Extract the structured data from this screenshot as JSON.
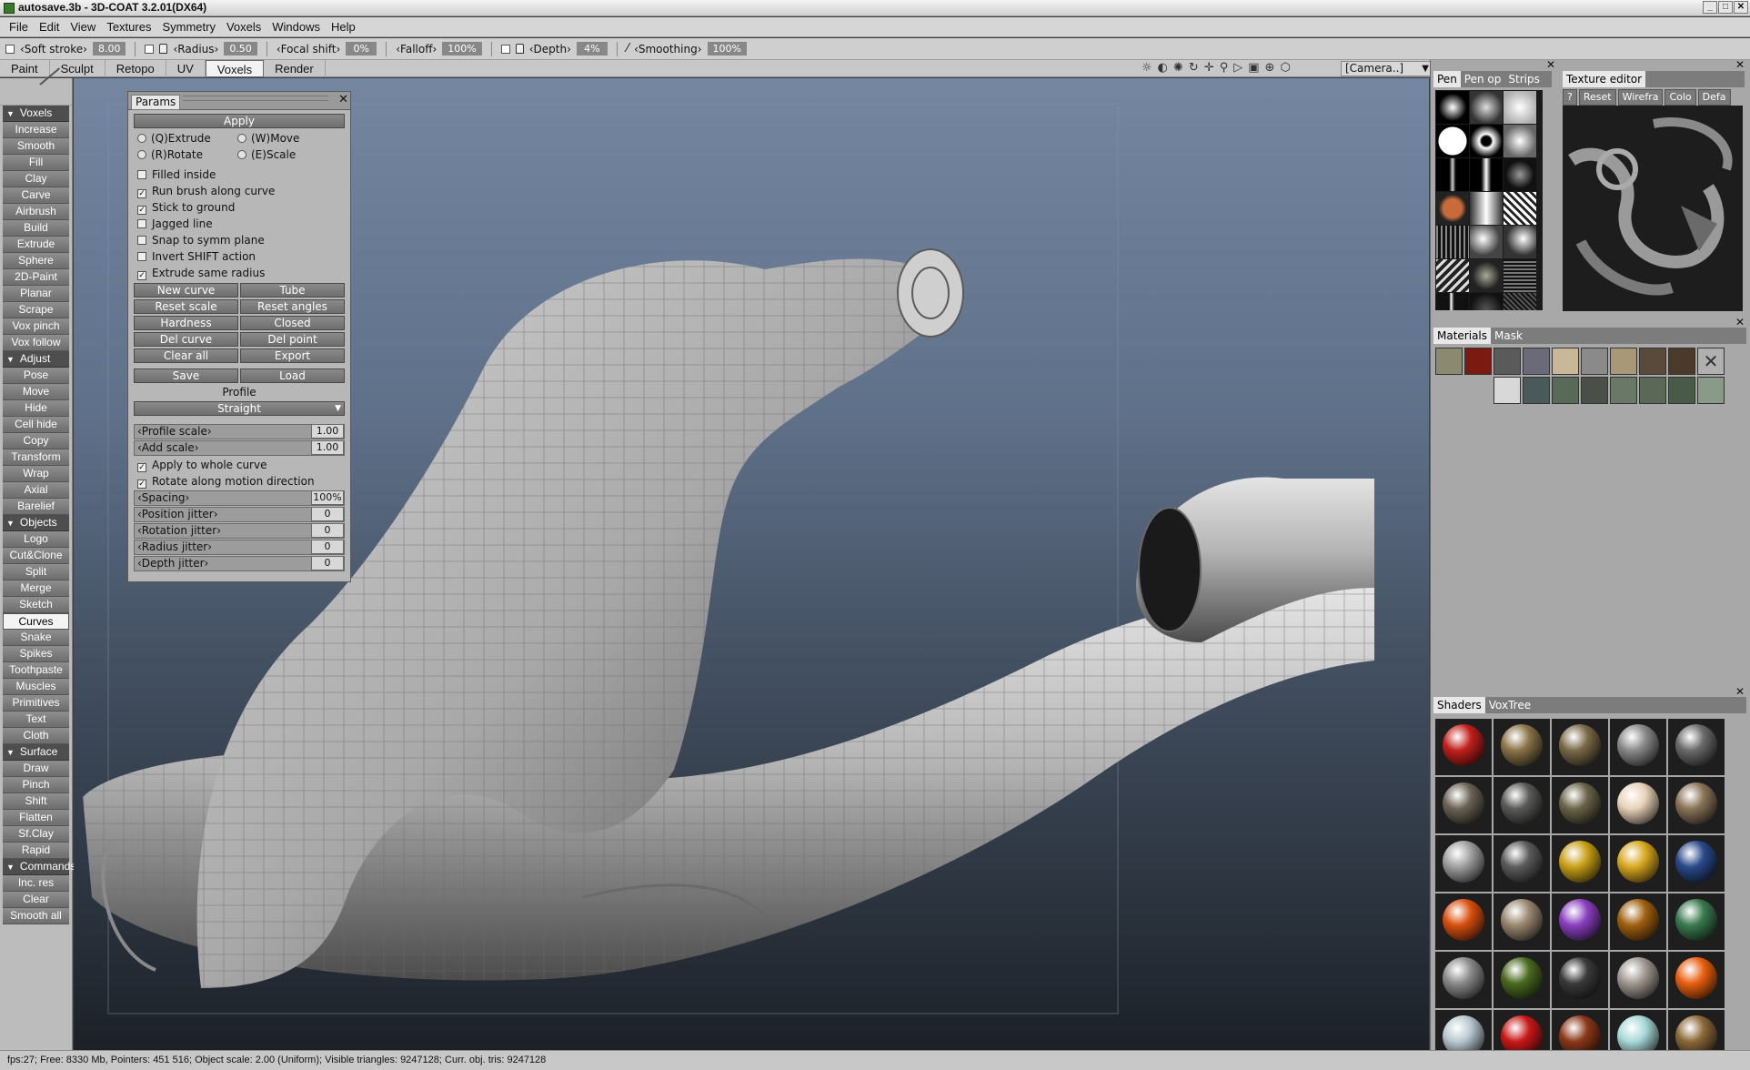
{
  "window": {
    "title": "autosave.3b - 3D-COAT 3.2.01(DX64)"
  },
  "menu": [
    "File",
    "Edit",
    "View",
    "Textures",
    "Symmetry",
    "Voxels",
    "Windows",
    "Help"
  ],
  "toolopts": {
    "soft_stroke_label": "‹Soft stroke›",
    "soft_stroke_value": "8.00",
    "radius_label": "‹Radius›",
    "radius_value": "0.50",
    "focal_label": "‹Focal shift›",
    "focal_value": "0%",
    "falloff_label": "‹Falloff›",
    "falloff_value": "100%",
    "depth_label": "‹Depth›",
    "depth_value": "4%",
    "smoothing_label": "‹Smoothing›",
    "smoothing_value": "100%"
  },
  "tabs": [
    "Paint",
    "Sculpt",
    "Retopo",
    "UV",
    "Voxels",
    "Render"
  ],
  "active_tab": "Voxels",
  "camera": "[Camera..]",
  "sidebar": [
    {
      "type": "section",
      "label": "Voxels"
    },
    {
      "label": "Increase"
    },
    {
      "label": "Smooth"
    },
    {
      "label": "Fill"
    },
    {
      "label": "Clay"
    },
    {
      "label": "Carve"
    },
    {
      "label": "Airbrush"
    },
    {
      "label": "Build"
    },
    {
      "label": "Extrude"
    },
    {
      "label": "Sphere"
    },
    {
      "label": "2D-Paint"
    },
    {
      "label": "Planar"
    },
    {
      "label": "Scrape"
    },
    {
      "label": "Vox pinch"
    },
    {
      "label": "Vox follow"
    },
    {
      "type": "section",
      "label": "Adjust"
    },
    {
      "label": "Pose"
    },
    {
      "label": "Move"
    },
    {
      "label": "Hide"
    },
    {
      "label": "Cell hide"
    },
    {
      "label": "Copy"
    },
    {
      "label": "Transform"
    },
    {
      "label": "Wrap"
    },
    {
      "label": "Axial"
    },
    {
      "label": "Barelief"
    },
    {
      "type": "section",
      "label": "Objects"
    },
    {
      "label": "Logo"
    },
    {
      "label": "Cut&Clone"
    },
    {
      "label": "Split"
    },
    {
      "label": "Merge"
    },
    {
      "label": "Sketch"
    },
    {
      "label": "Curves",
      "active": true
    },
    {
      "label": "Snake"
    },
    {
      "label": "Spikes"
    },
    {
      "label": "Toothpaste"
    },
    {
      "label": "Muscles"
    },
    {
      "label": "Primitives"
    },
    {
      "label": "Text"
    },
    {
      "label": "Cloth"
    },
    {
      "type": "section",
      "label": "Surface"
    },
    {
      "label": "Draw"
    },
    {
      "label": "Pinch"
    },
    {
      "label": "Shift"
    },
    {
      "label": "Flatten"
    },
    {
      "label": "Sf.Clay"
    },
    {
      "label": "Rapid"
    },
    {
      "type": "section",
      "label": "Commands"
    },
    {
      "label": "Inc. res"
    },
    {
      "label": "Clear"
    },
    {
      "label": "Smooth all"
    }
  ],
  "params": {
    "title": "Params",
    "apply": "Apply",
    "modes": [
      "(Q)Extrude",
      "(W)Move",
      "(R)Rotate",
      "(E)Scale"
    ],
    "checks": [
      {
        "label": "Filled inside",
        "checked": false
      },
      {
        "label": "Run brush along curve",
        "checked": true
      },
      {
        "label": "Stick to ground",
        "checked": true
      },
      {
        "label": "Jagged line",
        "checked": false
      },
      {
        "label": "Snap to symm plane",
        "checked": false
      },
      {
        "label": "Invert SHIFT action",
        "checked": false
      },
      {
        "label": "Extrude same radius",
        "checked": true
      }
    ],
    "buttons": [
      [
        "New curve",
        "Tube"
      ],
      [
        "Reset scale",
        "Reset angles"
      ],
      [
        "Hardness",
        "Closed"
      ],
      [
        "Del curve",
        "Del point"
      ],
      [
        "Clear all",
        "Export"
      ]
    ],
    "save": "Save",
    "load": "Load",
    "profile_label": "Profile",
    "profile_value": "Straight",
    "profile_scale_label": "‹Profile scale›",
    "profile_scale_value": "1.00",
    "add_scale_label": "‹Add scale›",
    "add_scale_value": "1.00",
    "apply_whole": "Apply to whole curve",
    "rotate_motion": "Rotate along motion direction",
    "sliders": [
      {
        "label": "‹Spacing›",
        "value": "100%"
      },
      {
        "label": "‹Position jitter›",
        "value": "0"
      },
      {
        "label": "‹Rotation jitter›",
        "value": "0"
      },
      {
        "label": "‹Radius jitter›",
        "value": "0"
      },
      {
        "label": "‹Depth jitter›",
        "value": "0"
      }
    ]
  },
  "right": {
    "brush_tabs": [
      "Pen",
      "Pen op",
      "Strips"
    ],
    "texture_editor_title": "Texture editor",
    "texture_editor_bar": [
      "?",
      "Reset",
      "Wirefra",
      "Colo",
      "Defa"
    ],
    "materials_tabs": [
      "Materials",
      "Mask"
    ],
    "shaders_tabs": [
      "Shaders",
      "VoxTree"
    ],
    "shader_colors": [
      "#c0201c",
      "#8a7448",
      "#7a6a48",
      "#8a8a8a",
      "#6a6a6a",
      "#6a6254",
      "#5a5a58",
      "#6a6448",
      "#e8d2b8",
      "#8a7458",
      "#a0a0a0",
      "#5c5c5c",
      "#c8a018",
      "#d8a820",
      "#2a4a8a",
      "#d85010",
      "#9a8870",
      "#8a40c0",
      "#a06010",
      "#3a7a50",
      "#8a8a8a",
      "#4a6a20",
      "#3a3a3a",
      "#a09890",
      "#e86010",
      "#b8c8d0",
      "#c81818",
      "#8a3818",
      "#a8d8d8",
      "#8a6838"
    ]
  },
  "status": "fps:27;     Free: 8330 Mb, Pointers: 451 516; Object scale: 2.00 (Uniform); Visible triangles: 9247128; Curr. obj. tris: 9247128"
}
